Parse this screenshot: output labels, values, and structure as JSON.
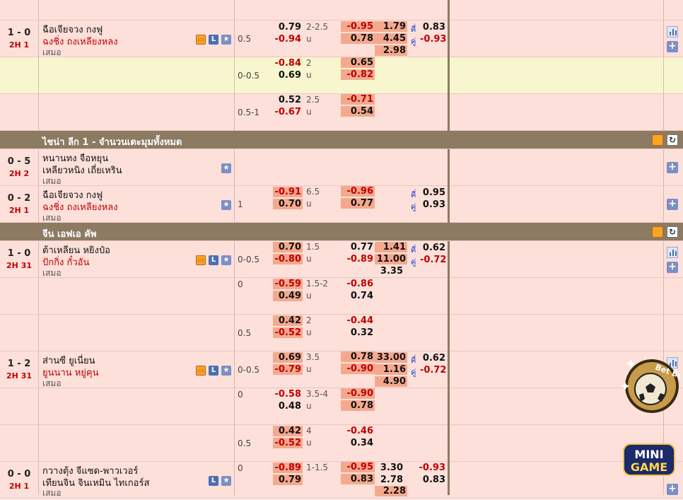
{
  "icons": {
    "tv": "tv-icon",
    "live": "L",
    "fav": "star-icon"
  },
  "plus": "+",
  "over_label": "u",
  "home_label": "คี่",
  "away_label": "คู่",
  "leagues": [
    {
      "name": "ไชน่า ลีก 1 - จำนวนเตะมุมทั้งหมด"
    },
    {
      "name": "จีน เอฟเอ คัพ"
    }
  ],
  "matches": [
    {
      "score": "1 - 0",
      "time": "2H 1",
      "home": "ฉือเจียจวง กงฟู",
      "away": "ฉงชิ่ง ถงเหลียงหลง",
      "draw": "เสมอ",
      "lines": [
        {
          "hdp": "0.5",
          "h1": "0.79",
          "h2": "-0.94",
          "goal": "2-2.5",
          "o1": "-0.95",
          "o2": "0.78",
          "x1": "1.79",
          "x2": "4.45",
          "x3": "2.98",
          "oe1": "0.83",
          "oe2": "-0.93"
        },
        {
          "hdp": "0-0.5",
          "h1": "-0.84",
          "h2": "0.69",
          "goal": "2",
          "o1": "0.65",
          "o2": "-0.82"
        },
        {
          "hdp": "0.5-1",
          "h1": "0.52",
          "h2": "-0.67",
          "goal": "2.5",
          "o1": "-0.71",
          "o2": "0.54"
        }
      ]
    },
    {
      "score": "0 - 5",
      "time": "2H 2",
      "home": "หนานทง จือหยุน",
      "away": "เหลียวหนิง เถี่ยเหริน",
      "draw": "เสมอ"
    },
    {
      "score": "0 - 2",
      "time": "2H 1",
      "home": "ฉือเจียจวง กงฟู",
      "away": "ฉงชิ่ง ถงเหลียงหลง",
      "draw": "เสมอ",
      "lines": [
        {
          "hdp": "1",
          "h1": "-0.91",
          "h2": "0.70",
          "goal": "6.5",
          "o1": "-0.96",
          "o2": "0.77",
          "oe1": "0.95",
          "oe2": "0.93"
        }
      ]
    },
    {
      "score": "1 - 0",
      "time": "2H 31",
      "home": "ต้าเหลียน หยิงป๋อ",
      "away": "ปักกิ่ง กั๋วอัน",
      "draw": "เสมอ",
      "lines": [
        {
          "hdp": "0-0.5",
          "h1": "0.70",
          "h2": "-0.80",
          "goal": "1.5",
          "o1": "0.77",
          "o2": "-0.89",
          "x1": "1.41",
          "x2": "11.00",
          "x3": "3.35",
          "oe1": "0.62",
          "oe2": "-0.72"
        },
        {
          "hdp": "0",
          "h1": "-0.59",
          "h2": "0.49",
          "goal": "1.5-2",
          "o1": "-0.86",
          "o2": "0.74"
        },
        {
          "hdp": "0.5",
          "h1": "0.42",
          "h2": "-0.52",
          "goal": "2",
          "o1": "-0.44",
          "o2": "0.32"
        }
      ]
    },
    {
      "score": "1 - 2",
      "time": "2H 31",
      "home": "ส่านซี ยูเนี่ยน",
      "away": "ยูนนาน หยู่คุน",
      "draw": "เสมอ",
      "lines": [
        {
          "hdp": "0-0.5",
          "h1": "0.69",
          "h2": "-0.79",
          "goal": "3.5",
          "o1": "0.78",
          "o2": "-0.90",
          "x1": "33.00",
          "x2": "1.16",
          "x3": "4.90",
          "oe1": "0.62",
          "oe2": "-0.72"
        },
        {
          "hdp": "0",
          "h1": "-0.58",
          "h2": "0.48",
          "goal": "3.5-4",
          "o1": "-0.90",
          "o2": "0.78"
        },
        {
          "hdp": "0.5",
          "h1": "0.42",
          "h2": "-0.52",
          "goal": "4",
          "o1": "-0.46",
          "o2": "0.34"
        }
      ]
    },
    {
      "score": "0 - 0",
      "time": "2H 1",
      "home": "กวางตุ้ง จีแซด-พาวเวอร์",
      "away": "เทียนจิน จินเหมิน ไทเกอร์ส",
      "draw": "เสมอ",
      "lines": [
        {
          "hdp": "0",
          "h1": "-0.89",
          "h2": "0.79",
          "goal": "1-1.5",
          "o1": "-0.95",
          "o2": "0.83",
          "x1": "3.30",
          "x2": "2.78",
          "x3": "2.28",
          "oe1": "-0.93",
          "oe2": "0.83"
        }
      ]
    }
  ],
  "promos": {
    "boost": "Bet Boost",
    "mini1": "MINI",
    "mini2": "GAME"
  }
}
